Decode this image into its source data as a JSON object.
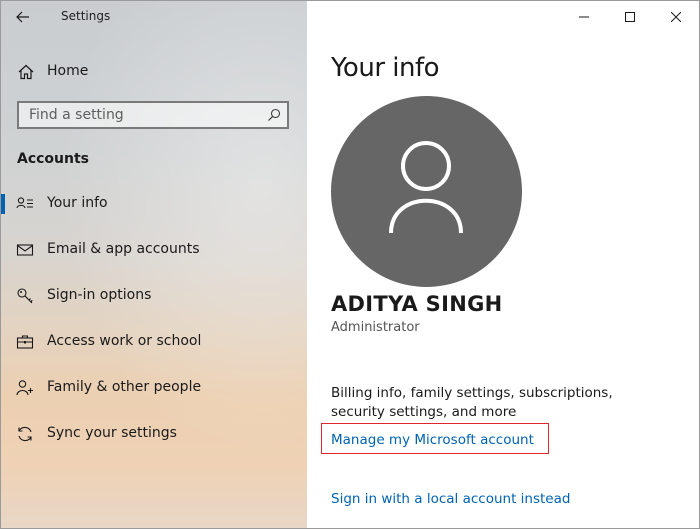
{
  "window": {
    "title": "Settings",
    "controls": {
      "minimize": "—",
      "maximize": "☐",
      "close": "✕"
    }
  },
  "sidebar": {
    "home_label": "Home",
    "search": {
      "placeholder": "Find a setting",
      "value": ""
    },
    "section_title": "Accounts",
    "items": [
      {
        "label": "Your info",
        "icon": "person-list-icon",
        "selected": true
      },
      {
        "label": "Email & app accounts",
        "icon": "mail-icon",
        "selected": false
      },
      {
        "label": "Sign-in options",
        "icon": "key-icon",
        "selected": false
      },
      {
        "label": "Access work or school",
        "icon": "briefcase-icon",
        "selected": false
      },
      {
        "label": "Family & other people",
        "icon": "person-add-icon",
        "selected": false
      },
      {
        "label": "Sync your settings",
        "icon": "sync-icon",
        "selected": false
      }
    ]
  },
  "main": {
    "title": "Your info",
    "user": {
      "name": "ADITYA SINGH",
      "role": "Administrator"
    },
    "billing_text": "Billing info, family settings, subscriptions, security settings, and more",
    "manage_link": "Manage my Microsoft account",
    "local_account_link": "Sign in with a local account instead"
  },
  "colors": {
    "accent": "#0063b1",
    "highlight_box": "#e0262f",
    "avatar_bg": "#666666"
  }
}
